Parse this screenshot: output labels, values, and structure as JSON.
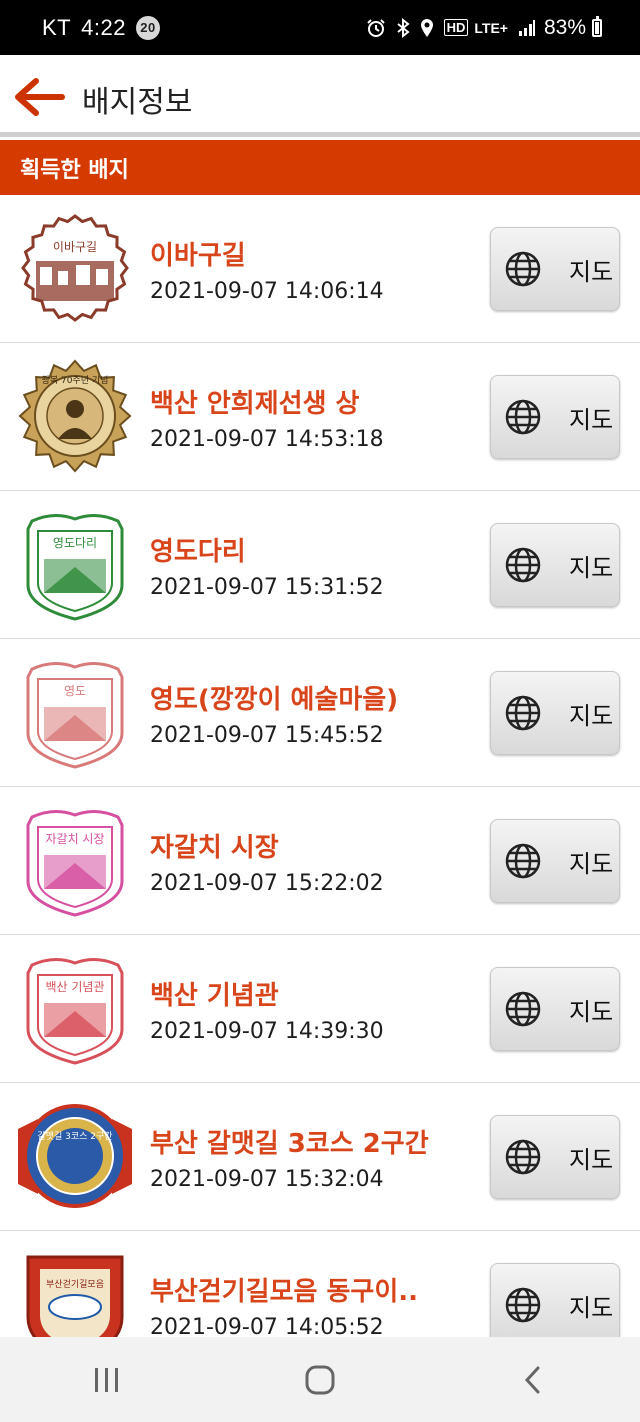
{
  "status_bar": {
    "carrier": "KT",
    "time": "4:22",
    "notification_count": "20",
    "network_hd": "HD",
    "network_lte": "LTE+",
    "battery_percent": "83%"
  },
  "header": {
    "title": "배지정보",
    "back_icon": "back-arrow-icon"
  },
  "section": {
    "title": "획득한 배지"
  },
  "map_button_label": "지도",
  "badges": [
    {
      "name": "이바구길",
      "date": "2021-09-07 14:06:14",
      "stamp_text": "이바구길",
      "color": "#8a3b2a",
      "shape": "scalloped"
    },
    {
      "name": "백산 안희제선생 상",
      "date": "2021-09-07 14:53:18",
      "stamp_text": "광복 70주년 기념",
      "color": "#8a6a2a",
      "shape": "medal"
    },
    {
      "name": "영도다리",
      "date": "2021-09-07 15:31:52",
      "stamp_text": "영도다리",
      "color": "#2e8b3a",
      "shape": "shield"
    },
    {
      "name": "영도(깡깡이 예술마을)",
      "date": "2021-09-07 15:45:52",
      "stamp_text": "영도",
      "color": "#d97a7a",
      "shape": "shield"
    },
    {
      "name": "자갈치 시장",
      "date": "2021-09-07 15:22:02",
      "stamp_text": "자갈치 시장",
      "color": "#d64fa0",
      "shape": "shield"
    },
    {
      "name": "백산 기념관",
      "date": "2021-09-07 14:39:30",
      "stamp_text": "백산 기념관",
      "color": "#d8505a",
      "shape": "shield"
    },
    {
      "name": "부산 갈맷길 3코스 2구간",
      "date": "2021-09-07 15:32:04",
      "stamp_text": "갈맷길 3코스 2구간",
      "color": "#2a6bb0",
      "shape": "ribbon"
    },
    {
      "name": "부산걷기길모음 동구이..",
      "date": "2021-09-07 14:05:52",
      "stamp_text": "부산걷기길모음",
      "color": "#c8321e",
      "shape": "crest"
    }
  ],
  "nav": {
    "recent_icon": "recent-apps-icon",
    "home_icon": "home-icon",
    "back_icon": "nav-back-icon"
  },
  "colors": {
    "accent": "#d53a00",
    "badge_name": "#d8451b"
  }
}
